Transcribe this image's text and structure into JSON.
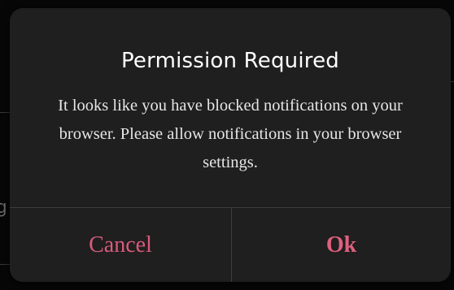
{
  "dialog": {
    "title": "Permission Required",
    "message": "It looks like you have blocked notifications on your browser. Please allow notifications in your browser settings.",
    "cancel_label": "Cancel",
    "ok_label": "Ok"
  },
  "colors": {
    "dialog_background": "#1f1f1f",
    "accent": "#e0607e",
    "title": "#ffffff",
    "message": "#e6e6e6"
  }
}
